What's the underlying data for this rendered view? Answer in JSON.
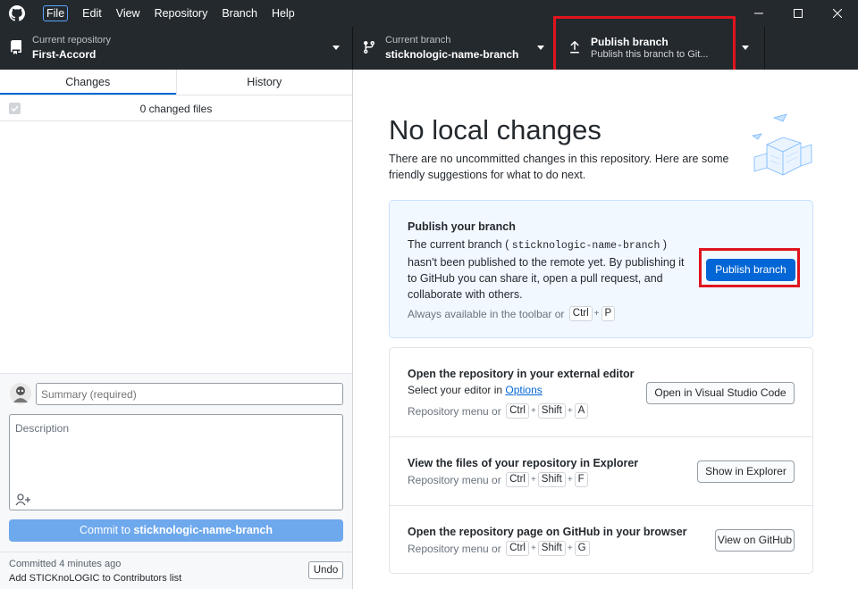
{
  "menu": {
    "items": [
      "File",
      "Edit",
      "View",
      "Repository",
      "Branch",
      "Help"
    ]
  },
  "toolbar": {
    "repo_label": "Current repository",
    "repo_value": "First-Accord",
    "branch_label": "Current branch",
    "branch_value": "sticknologic-name-branch",
    "publish_label": "Publish branch",
    "publish_sub": "Publish this branch to Git..."
  },
  "left": {
    "tabs": [
      "Changes",
      "History"
    ],
    "changed_files": "0 changed files",
    "summary_placeholder": "Summary (required)",
    "description_placeholder": "Description",
    "commit_prefix": "Commit to ",
    "commit_branch": "sticknologic-name-branch",
    "last_commit_time": "Committed 4 minutes ago",
    "last_commit_msg": "Add STICKnoLOGIC to Contributors list",
    "undo_label": "Undo"
  },
  "right": {
    "title": "No local changes",
    "subtitle": "There are no uncommitted changes in this repository. Here are some friendly suggestions for what to do next.",
    "publish_card": {
      "heading": "Publish your branch",
      "body_pre": "The current branch ( ",
      "branch_code": "sticknologic-name-branch",
      "body_post": " ) hasn't been published to the remote yet. By publishing it to GitHub you can share it, open a pull request, and collaborate with others.",
      "hint": "Always available in the toolbar or",
      "keys": [
        "Ctrl",
        "P"
      ],
      "button": "Publish branch"
    },
    "suggestions": [
      {
        "heading": "Open the repository in your external editor",
        "sub_pre": "Select your editor in ",
        "sub_link": "Options",
        "hint": "Repository menu or",
        "keys": [
          "Ctrl",
          "Shift",
          "A"
        ],
        "button": "Open in Visual Studio Code"
      },
      {
        "heading": "View the files of your repository in Explorer",
        "hint": "Repository menu or",
        "keys": [
          "Ctrl",
          "Shift",
          "F"
        ],
        "button": "Show in Explorer"
      },
      {
        "heading": "Open the repository page on GitHub in your browser",
        "hint": "Repository menu or",
        "keys": [
          "Ctrl",
          "Shift",
          "G"
        ],
        "button": "View on GitHub"
      }
    ]
  },
  "colors": {
    "toolbar_bg": "#24292e",
    "accent_blue": "#0366d6",
    "highlight_red": "#e0141e",
    "commit_button_disabled": "#6ea8ed"
  }
}
